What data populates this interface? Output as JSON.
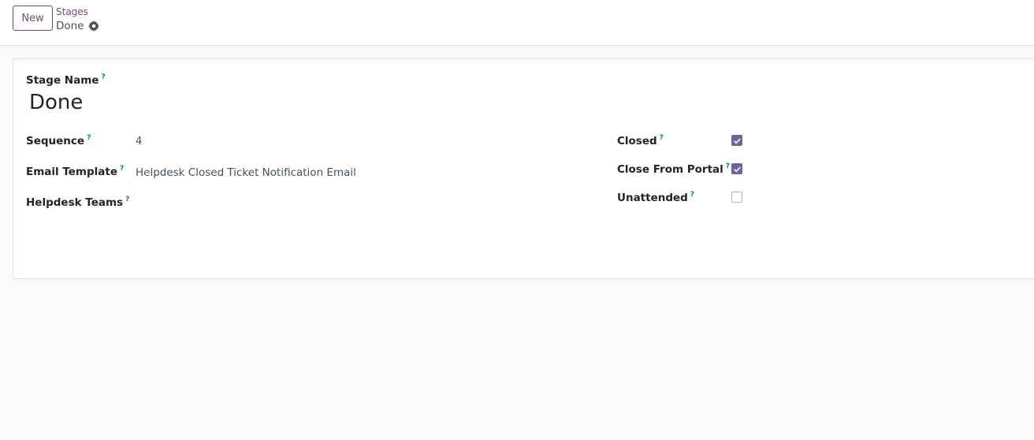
{
  "toolbar": {
    "new_label": "New",
    "breadcrumb_parent": "Stages",
    "breadcrumb_current": "Done"
  },
  "form": {
    "stage_name_label": "Stage Name",
    "stage_name_value": "Done",
    "help_mark": "?",
    "sequence_label": "Sequence",
    "sequence_value": "4",
    "email_template_label": "Email Template",
    "email_template_value": "Helpdesk Closed Ticket Notification Email",
    "teams_label": "Helpdesk Teams",
    "closed_label": "Closed",
    "closed_checked": true,
    "close_from_portal_label": "Close From Portal",
    "close_from_portal_checked": true,
    "unattended_label": "Unattended",
    "unattended_checked": false
  },
  "colors": {
    "accent": "#714b67",
    "checkbox": "#71639e",
    "help": "#017e84"
  }
}
